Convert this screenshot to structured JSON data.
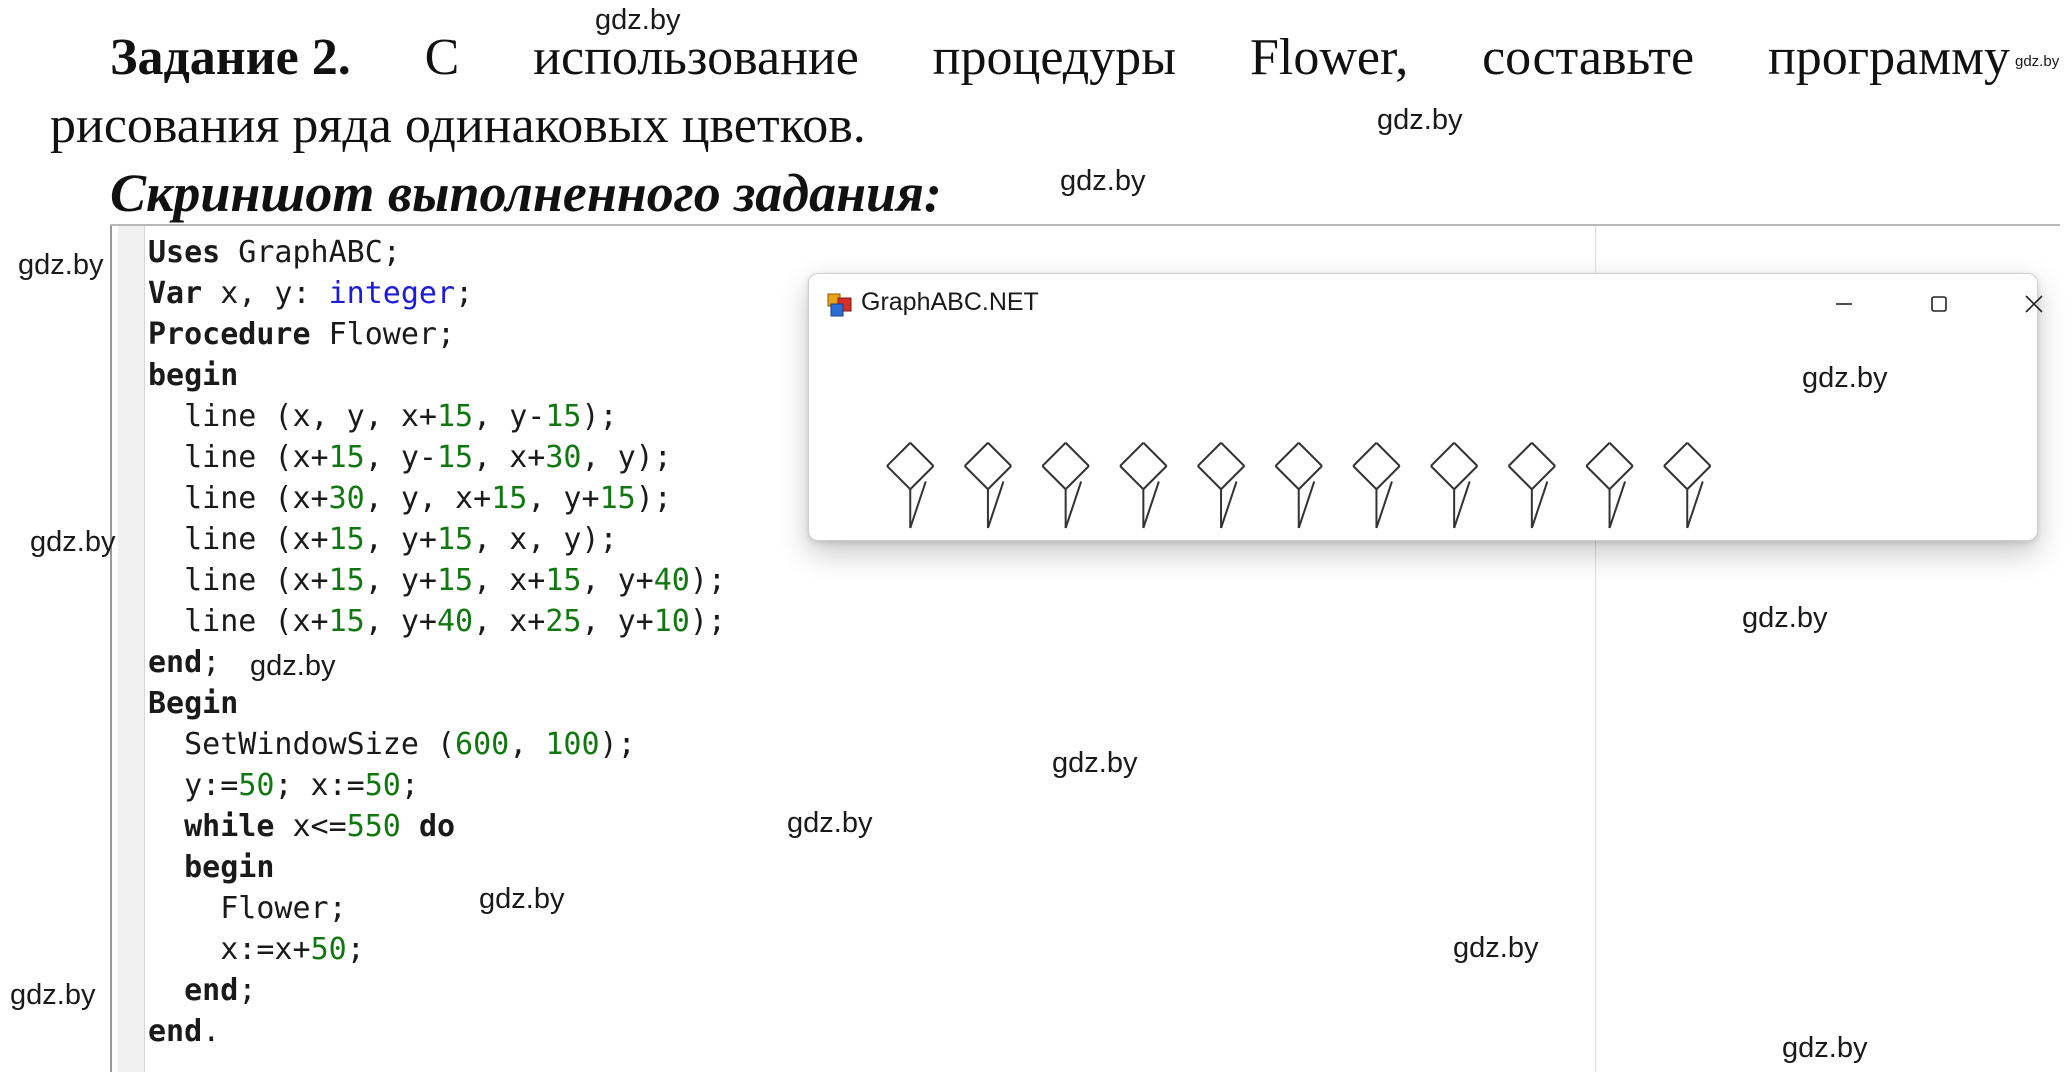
{
  "task": {
    "label": "Задание 2.",
    "words": [
      "С",
      "использование",
      "процедуры",
      "Flower,",
      "составьте",
      "программу"
    ],
    "line2": "рисования ряда одинаковых цветков."
  },
  "screenshot_title": "Скриншот выполненного задания:",
  "watermark": "gdz.by",
  "code": {
    "lines": [
      [
        {
          "t": "Uses",
          "c": "kw"
        },
        {
          "t": " GraphABC;",
          "c": ""
        }
      ],
      [
        {
          "t": "Var",
          "c": "kw"
        },
        {
          "t": " x, y: ",
          "c": ""
        },
        {
          "t": "integer",
          "c": "ty"
        },
        {
          "t": ";",
          "c": ""
        }
      ],
      [
        {
          "t": "Procedure",
          "c": "kw"
        },
        {
          "t": " Flower;",
          "c": ""
        }
      ],
      [
        {
          "t": "begin",
          "c": "kw"
        }
      ],
      [
        {
          "t": "  line (x, y, x+",
          "c": ""
        },
        {
          "t": "15",
          "c": "nm"
        },
        {
          "t": ", y-",
          "c": ""
        },
        {
          "t": "15",
          "c": "nm"
        },
        {
          "t": ");",
          "c": ""
        }
      ],
      [
        {
          "t": "  line (x+",
          "c": ""
        },
        {
          "t": "15",
          "c": "nm"
        },
        {
          "t": ", y-",
          "c": ""
        },
        {
          "t": "15",
          "c": "nm"
        },
        {
          "t": ", x+",
          "c": ""
        },
        {
          "t": "30",
          "c": "nm"
        },
        {
          "t": ", y);",
          "c": ""
        }
      ],
      [
        {
          "t": "  line (x+",
          "c": ""
        },
        {
          "t": "30",
          "c": "nm"
        },
        {
          "t": ", y, x+",
          "c": ""
        },
        {
          "t": "15",
          "c": "nm"
        },
        {
          "t": ", y+",
          "c": ""
        },
        {
          "t": "15",
          "c": "nm"
        },
        {
          "t": ");",
          "c": ""
        }
      ],
      [
        {
          "t": "  line (x+",
          "c": ""
        },
        {
          "t": "15",
          "c": "nm"
        },
        {
          "t": ", y+",
          "c": ""
        },
        {
          "t": "15",
          "c": "nm"
        },
        {
          "t": ", x, y);",
          "c": ""
        }
      ],
      [
        {
          "t": "  line (x+",
          "c": ""
        },
        {
          "t": "15",
          "c": "nm"
        },
        {
          "t": ", y+",
          "c": ""
        },
        {
          "t": "15",
          "c": "nm"
        },
        {
          "t": ", x+",
          "c": ""
        },
        {
          "t": "15",
          "c": "nm"
        },
        {
          "t": ", y+",
          "c": ""
        },
        {
          "t": "40",
          "c": "nm"
        },
        {
          "t": ");",
          "c": ""
        }
      ],
      [
        {
          "t": "  line (x+",
          "c": ""
        },
        {
          "t": "15",
          "c": "nm"
        },
        {
          "t": ", y+",
          "c": ""
        },
        {
          "t": "40",
          "c": "nm"
        },
        {
          "t": ", x+",
          "c": ""
        },
        {
          "t": "25",
          "c": "nm"
        },
        {
          "t": ", y+",
          "c": ""
        },
        {
          "t": "10",
          "c": "nm"
        },
        {
          "t": ");",
          "c": ""
        }
      ],
      [
        {
          "t": "end",
          "c": "kw"
        },
        {
          "t": ";",
          "c": ""
        }
      ],
      [
        {
          "t": "Begin",
          "c": "kw"
        }
      ],
      [
        {
          "t": "  SetWindowSize (",
          "c": ""
        },
        {
          "t": "600",
          "c": "nm"
        },
        {
          "t": ", ",
          "c": ""
        },
        {
          "t": "100",
          "c": "nm"
        },
        {
          "t": ");",
          "c": ""
        }
      ],
      [
        {
          "t": "  y:=",
          "c": ""
        },
        {
          "t": "50",
          "c": "nm"
        },
        {
          "t": "; x:=",
          "c": ""
        },
        {
          "t": "50",
          "c": "nm"
        },
        {
          "t": ";",
          "c": ""
        }
      ],
      [
        {
          "t": "  ",
          "c": ""
        },
        {
          "t": "while",
          "c": "kw"
        },
        {
          "t": " x<=",
          "c": ""
        },
        {
          "t": "550",
          "c": "nm"
        },
        {
          "t": " ",
          "c": ""
        },
        {
          "t": "do",
          "c": "kw"
        }
      ],
      [
        {
          "t": "  ",
          "c": ""
        },
        {
          "t": "begin",
          "c": "kw"
        }
      ],
      [
        {
          "t": "    Flower;",
          "c": ""
        }
      ],
      [
        {
          "t": "    x:=x+",
          "c": ""
        },
        {
          "t": "50",
          "c": "nm"
        },
        {
          "t": ";",
          "c": ""
        }
      ],
      [
        {
          "t": "  ",
          "c": ""
        },
        {
          "t": "end",
          "c": "kw"
        },
        {
          "t": ";",
          "c": ""
        }
      ],
      [
        {
          "t": "end",
          "c": "kw"
        },
        {
          "t": ".",
          "c": ""
        }
      ]
    ]
  },
  "graph_window": {
    "title": "GraphABC.NET",
    "flower_count": 11,
    "line_color": "#333333"
  }
}
